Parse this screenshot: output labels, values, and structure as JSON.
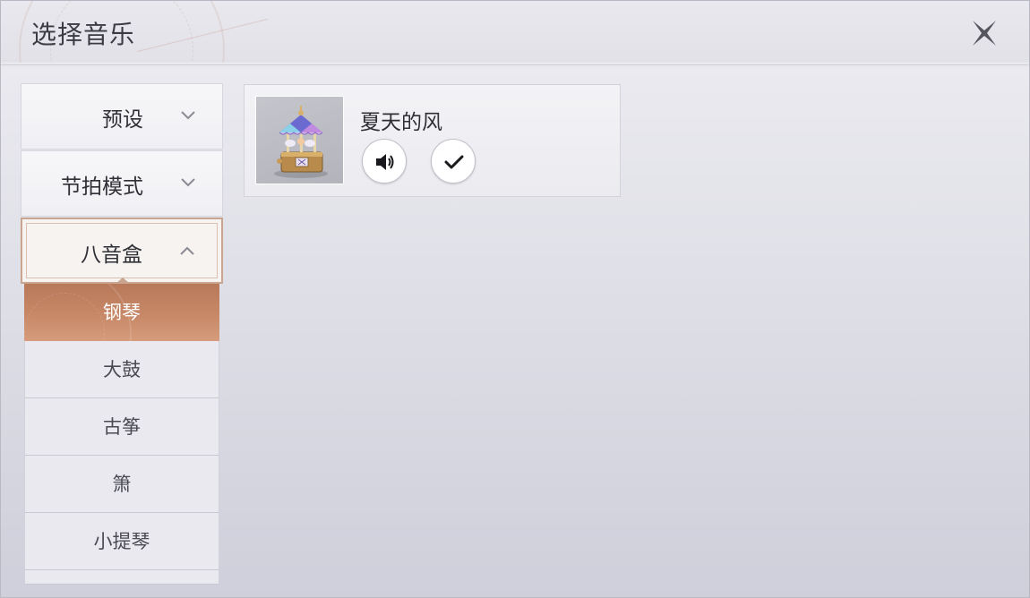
{
  "header": {
    "title": "选择音乐"
  },
  "sidebar": {
    "categories": [
      {
        "label": "预设",
        "expanded": false
      },
      {
        "label": "节拍模式",
        "expanded": false
      },
      {
        "label": "八音盒",
        "expanded": true
      }
    ],
    "instruments": [
      {
        "label": "钢琴",
        "selected": true
      },
      {
        "label": "大鼓",
        "selected": false
      },
      {
        "label": "古筝",
        "selected": false
      },
      {
        "label": "箫",
        "selected": false
      },
      {
        "label": "小提琴",
        "selected": false
      }
    ]
  },
  "music_list": [
    {
      "name": "夏天的风",
      "thumbnail_icon": "carousel-music-box-icon",
      "actions": [
        "speaker-icon",
        "check-icon"
      ]
    }
  ],
  "colors": {
    "accent": "#c98a69",
    "accent_dark": "#b8795a",
    "text": "#2f2f36"
  }
}
